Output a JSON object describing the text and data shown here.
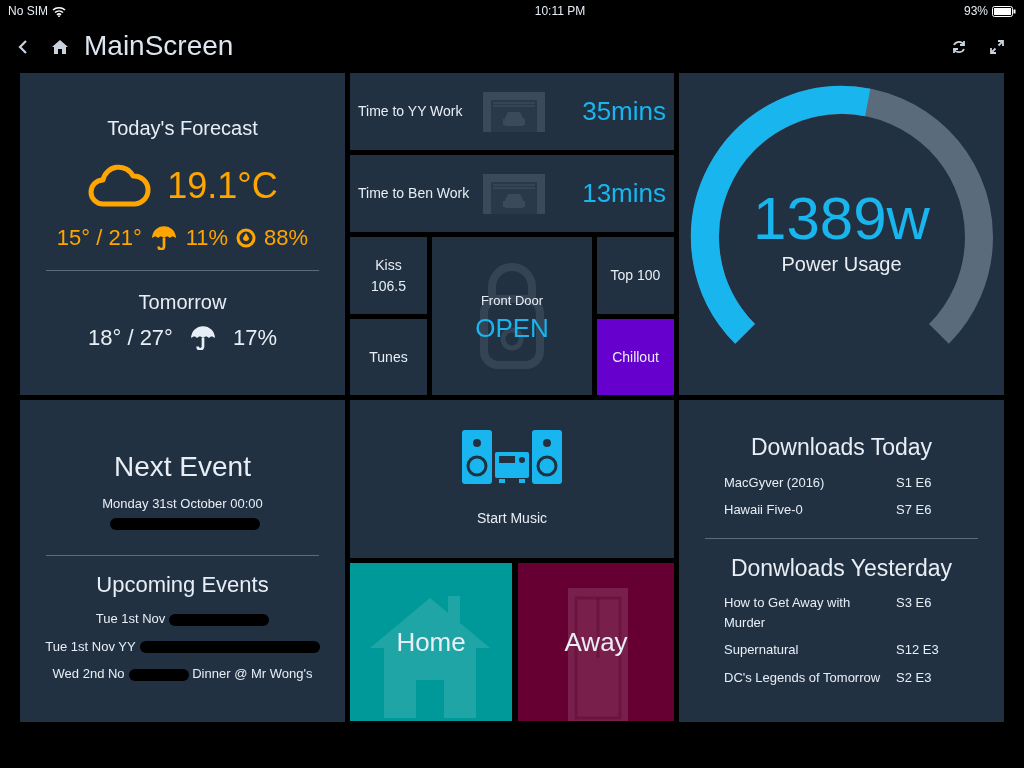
{
  "status_bar": {
    "carrier": "No SIM",
    "time": "10:11 PM",
    "battery": "93%"
  },
  "header": {
    "title": "MainScreen"
  },
  "forecast": {
    "title": "Today's Forecast",
    "temperature": "19.1°C",
    "range": "15° / 21°",
    "rain": "11%",
    "humidity": "88%",
    "tomorrow_title": "Tomorrow",
    "tomorrow_range": "18° / 27°",
    "tomorrow_rain": "17%"
  },
  "commutes": [
    {
      "label": "Time to YY Work",
      "value": "35",
      "unit": "mins"
    },
    {
      "label": "Time to Ben Work",
      "value": "13",
      "unit": "mins"
    }
  ],
  "stations": [
    {
      "label": "Kiss 106.5",
      "selected": false
    },
    {
      "label": "Tunes",
      "selected": false
    },
    {
      "label": "Top 100",
      "selected": false
    },
    {
      "label": "Chillout",
      "selected": true
    }
  ],
  "front_door": {
    "label": "Front Door",
    "state": "OPEN"
  },
  "power": {
    "value": "1389w",
    "label": "Power Usage",
    "level": 0.54
  },
  "events": {
    "title": "Next Event",
    "next": {
      "before": "Monday 31st October 00:00",
      "redacted": true
    },
    "upcoming_title": "Upcoming Events",
    "upcoming": [
      {
        "before": "Tue 1st Nov",
        "redacted": true
      },
      {
        "before": "Tue 1st Nov YY",
        "redacted": true
      },
      {
        "before": "Wed 2nd No",
        "after": "Dinner @ Mr Wong's",
        "redacted": true
      }
    ]
  },
  "music": {
    "label": "Start Music"
  },
  "modes": [
    {
      "label": "Home",
      "kind": "home",
      "color": "#009999"
    },
    {
      "label": "Away",
      "kind": "away",
      "color": "#660033"
    }
  ],
  "downloads": {
    "today_title": "Downloads Today",
    "today": [
      {
        "title": "MacGyver (2016)",
        "episode": "S1 E6"
      },
      {
        "title": "Hawaii Five-0",
        "episode": "S7 E6"
      }
    ],
    "yesterday_title": "Donwloads Yesterday",
    "yesterday": [
      {
        "title": "How to Get Away with Murder",
        "episode": "S3 E6"
      },
      {
        "title": "Supernatural",
        "episode": "S12 E3"
      },
      {
        "title": "DC's Legends of Tomorrow",
        "episode": "S2 E3"
      }
    ]
  }
}
